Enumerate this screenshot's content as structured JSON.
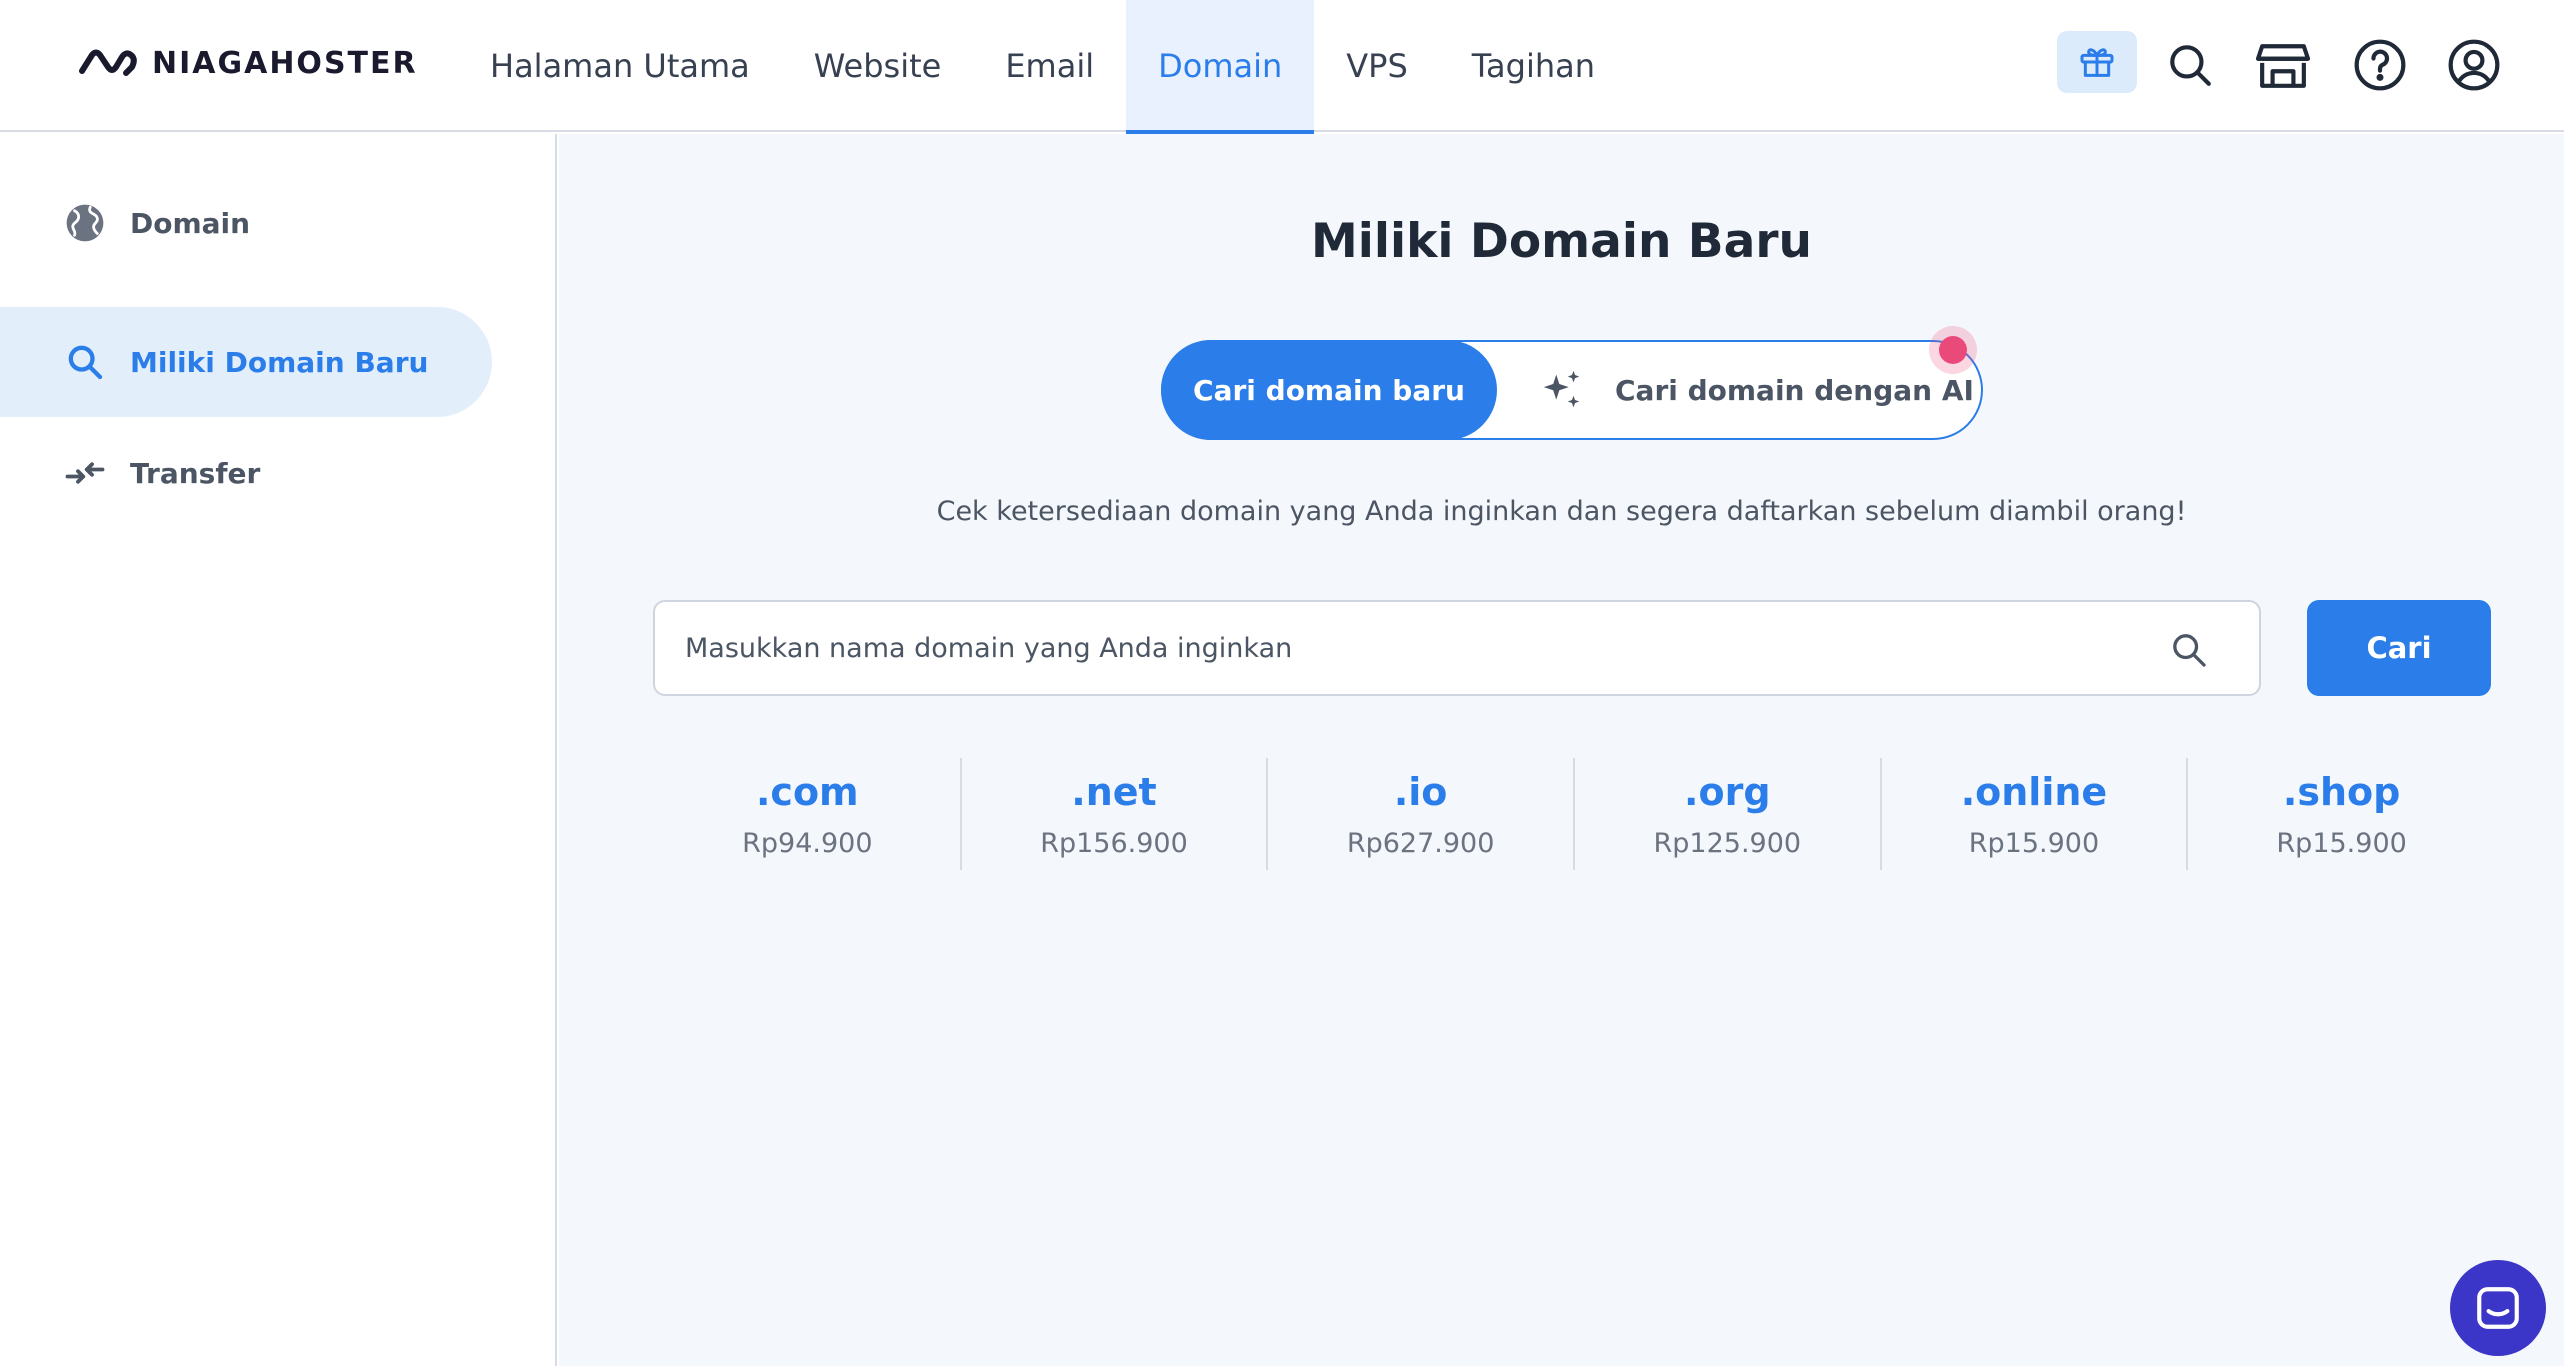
{
  "brand": {
    "name": "NIAGAHOSTER"
  },
  "nav": {
    "items": [
      {
        "label": "Halaman Utama"
      },
      {
        "label": "Website"
      },
      {
        "label": "Email"
      },
      {
        "label": "Domain"
      },
      {
        "label": "VPS"
      },
      {
        "label": "Tagihan"
      }
    ],
    "active": "Domain"
  },
  "header_icons": [
    "gift-icon",
    "search-icon",
    "store-icon",
    "help-icon",
    "account-icon"
  ],
  "sidebar": {
    "items": [
      {
        "label": "Domain",
        "icon": "globe-icon"
      },
      {
        "label": "Miliki Domain Baru",
        "icon": "search-icon"
      },
      {
        "label": "Transfer",
        "icon": "transfer-icon"
      }
    ],
    "active": "Miliki Domain Baru"
  },
  "main": {
    "title": "Miliki Domain Baru",
    "toggle": {
      "option_search": "Cari domain baru",
      "option_ai": "Cari domain dengan AI"
    },
    "subtitle": "Cek ketersediaan domain yang Anda inginkan dan segera daftarkan sebelum diambil orang!",
    "search": {
      "placeholder": "Masukkan nama domain yang Anda inginkan",
      "value": "",
      "button_label": "Cari"
    },
    "tlds": [
      {
        "name": ".com",
        "price": "Rp94.900"
      },
      {
        "name": ".net",
        "price": "Rp156.900"
      },
      {
        "name": ".io",
        "price": "Rp627.900"
      },
      {
        "name": ".org",
        "price": "Rp125.900"
      },
      {
        "name": ".online",
        "price": "Rp15.900"
      },
      {
        "name": ".shop",
        "price": "Rp15.900"
      }
    ]
  },
  "colors": {
    "accent": "#2b7de9",
    "accent_light": "#e3eefb",
    "notification": "#e94a7a",
    "chat": "#3b35c8",
    "background": "#f4f7fb"
  }
}
